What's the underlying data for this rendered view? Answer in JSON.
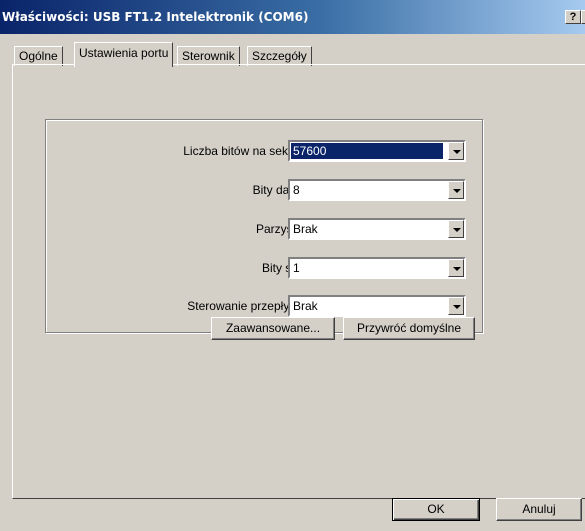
{
  "window": {
    "title": "Właściwości: USB FT1.2 Intelektronik (COM6)",
    "help_label": "?",
    "close_label": "×"
  },
  "tabs": [
    {
      "label": "Ogólne",
      "active": false
    },
    {
      "label": "Ustawienia portu",
      "active": true
    },
    {
      "label": "Sterownik",
      "active": false
    },
    {
      "label": "Szczegóły",
      "active": false
    }
  ],
  "port_settings": {
    "bits_per_second": {
      "label": "Liczba bitów na sekundę:",
      "value": "57600"
    },
    "data_bits": {
      "label": "Bity danych:",
      "value": "8"
    },
    "parity": {
      "label": "Parzystość:",
      "value": "Brak"
    },
    "stop_bits": {
      "label": "Bity stopu:",
      "value": "1"
    },
    "flow_control": {
      "label": "Sterowanie przepływem:",
      "value": "Brak"
    }
  },
  "buttons": {
    "advanced": "Zaawansowane...",
    "restore_defaults": "Przywróć domyślne",
    "ok": "OK",
    "cancel": "Anuluj"
  },
  "colors": {
    "titlebar_start": "#0a246a",
    "titlebar_end": "#a6caf0",
    "face": "#d4d0c8",
    "selection": "#0a246a"
  }
}
